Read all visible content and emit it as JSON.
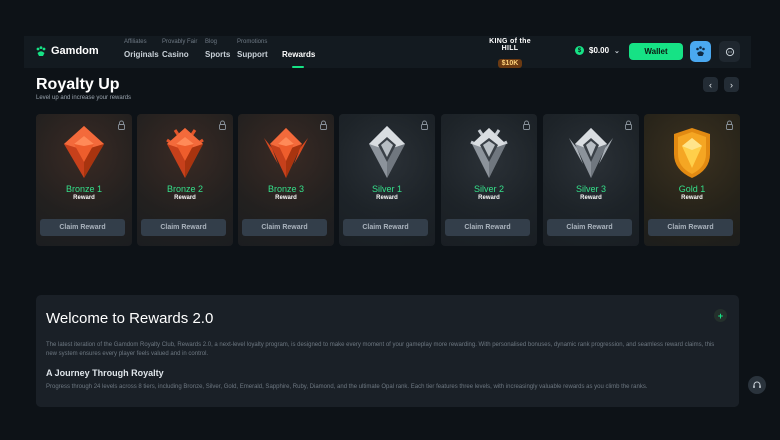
{
  "nav": {
    "logo_text": "Gamdom",
    "groups": [
      {
        "small": "Affiliates",
        "big": "Originals"
      },
      {
        "small": "Provably Fair",
        "big": "Casino"
      },
      {
        "small": "Blog",
        "big": "Sports"
      },
      {
        "small": "Promotions",
        "big": "Support"
      },
      {
        "small": "",
        "big": "Rewards"
      }
    ],
    "koth_title": "KING of the HILL",
    "koth_prize": "$10K",
    "balance": "$0.00",
    "wallet_label": "Wallet"
  },
  "page": {
    "title": "Royalty Up",
    "subtitle": "Level up and increase your rewards"
  },
  "cards": [
    {
      "tier": "Bronze 1",
      "sub": "Reward",
      "claim": "Claim Reward",
      "kind": "bronze",
      "icon": "bronze-badge-icon"
    },
    {
      "tier": "Bronze 2",
      "sub": "Reward",
      "claim": "Claim Reward",
      "kind": "bronze",
      "icon": "bronze-badge-icon"
    },
    {
      "tier": "Bronze 3",
      "sub": "Reward",
      "claim": "Claim Reward",
      "kind": "bronze",
      "icon": "bronze-badge-icon"
    },
    {
      "tier": "Silver 1",
      "sub": "Reward",
      "claim": "Claim Reward",
      "kind": "silver",
      "icon": "silver-badge-icon"
    },
    {
      "tier": "Silver 2",
      "sub": "Reward",
      "claim": "Claim Reward",
      "kind": "silver",
      "icon": "silver-badge-icon"
    },
    {
      "tier": "Silver 3",
      "sub": "Reward",
      "claim": "Claim Reward",
      "kind": "silver",
      "icon": "silver-badge-icon"
    },
    {
      "tier": "Gold 1",
      "sub": "Reward",
      "claim": "Claim Reward",
      "kind": "gold",
      "icon": "gold-badge-icon"
    }
  ],
  "info": {
    "title": "Welcome to Rewards 2.0",
    "para1": "The latest iteration of the Gamdom Royalty Club, Rewards 2.0, a next-level loyalty program, is designed to make every moment of your gameplay more rewarding. With personalised bonuses, dynamic rank progression, and seamless reward claims, this new system ensures every player feels valued and in control.",
    "heading2": "A Journey Through Royalty",
    "para2": "Progress through 24 levels across 8 tiers, including Bronze, Silver, Gold, Emerald, Sapphire, Ruby, Diamond, and the ultimate Opal rank. Each tier features three levels, with increasingly valuable rewards as you climb the ranks."
  },
  "colors": {
    "accent": "#16e285",
    "bronze": "#e2552a",
    "silver": "#c9ced4",
    "gold": "#f5a623"
  }
}
